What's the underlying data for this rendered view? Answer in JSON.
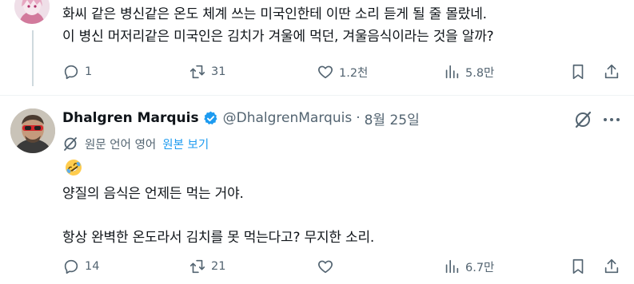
{
  "reply_top": {
    "text_lines": [
      "화씨 같은 병신같은 온도 체계 쓰는 미국인한테 이딴 소리 듣게 될 줄 몰랐네.",
      "이 병신 머저리같은 미국인은 김치가 겨울에 먹던, 겨울음식이라는 것을 알까?"
    ],
    "actions": {
      "replies": "1",
      "reposts": "31",
      "likes": "1.2천",
      "views": "5.8만"
    }
  },
  "reply_main": {
    "display_name": "Dhalgren Marquis",
    "handle": "@DhalgrenMarquis",
    "separator": "·",
    "date": "8월 25일",
    "translate": {
      "label": "원문 언어 영어",
      "link": "원본 보기"
    },
    "emoji_name": "rolling-on-floor-laughing",
    "text_lines": [
      "양질의 음식은 언제든 먹는 거야.",
      "항상 완벽한 온도라서 김치를 못 먹는다고? 무지한 소리."
    ],
    "actions": {
      "replies": "14",
      "reposts": "21",
      "likes": "",
      "views": "6.7만"
    }
  },
  "icons": {
    "reply": "reply-icon",
    "repost": "repost-icon",
    "like": "heart-icon",
    "views": "views-icon",
    "bookmark": "bookmark-icon",
    "share": "share-icon",
    "verified": "verified-badge-icon",
    "grok": "grok-icon",
    "more": "more-icon",
    "translate": "translate-icon"
  },
  "colors": {
    "text": "#0f1419",
    "secondary": "#536471",
    "link": "#1d9bf0",
    "verified": "#1d9bf0",
    "divider": "#eff3f4"
  }
}
